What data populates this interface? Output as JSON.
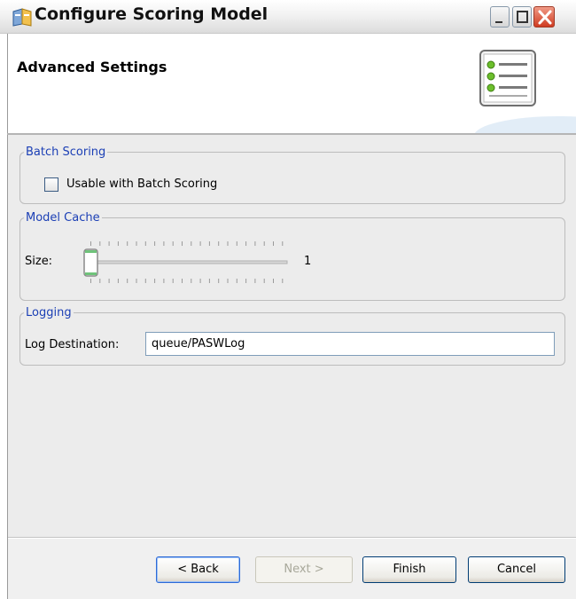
{
  "window": {
    "title": "Configure Scoring Model"
  },
  "header": {
    "title": "Advanced Settings",
    "icon": "settings-list-icon"
  },
  "batch_scoring": {
    "legend": "Batch Scoring",
    "checkbox_label": "Usable with Batch Scoring",
    "checked": false
  },
  "model_cache": {
    "legend": "Model Cache",
    "size_label": "Size:",
    "size_value": "1"
  },
  "logging": {
    "legend": "Logging",
    "destination_label": "Log Destination:",
    "destination_value": "queue/PASWLog"
  },
  "buttons": {
    "back": "< Back",
    "next": "Next >",
    "finish": "Finish",
    "cancel": "Cancel"
  },
  "colors": {
    "legend_text": "#1b3fb5",
    "body_background": "#ececec",
    "close_button": "#cf3c22"
  }
}
